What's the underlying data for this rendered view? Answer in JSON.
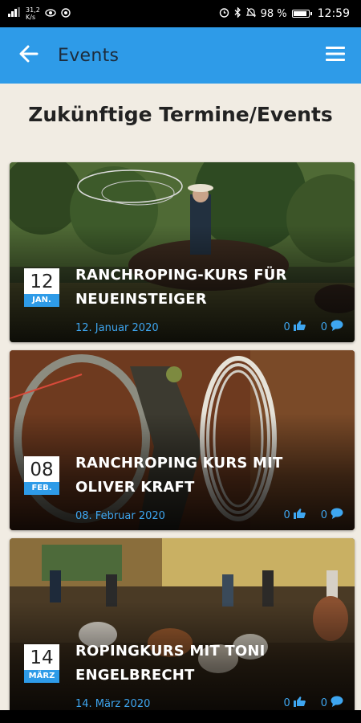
{
  "status_bar": {
    "speed_value": "31,2",
    "speed_unit": "K/s",
    "battery": "98 %",
    "time": "12:59"
  },
  "app_bar": {
    "title": "Events",
    "back_icon": "arrow-left-icon",
    "menu_icon": "hamburger-menu-icon"
  },
  "heading": "Zukünftige Termine/Events",
  "colors": {
    "accent": "#2e9be8",
    "link": "#3ea6f0",
    "background": "#f1ece3"
  },
  "events": [
    {
      "day": "12",
      "month": "JAN.",
      "title": "RANCHROPING-KURS FÜR NEUEINSTEIGER",
      "date": "12. Januar 2020",
      "likes": "0",
      "comments": "0"
    },
    {
      "day": "08",
      "month": "FEB.",
      "title": "RANCHROPING KURS MIT OLIVER KRAFT",
      "date": "08. Februar 2020",
      "likes": "0",
      "comments": "0"
    },
    {
      "day": "14",
      "month": "MÄRZ",
      "title": "ROPINGKURS MIT TONI ENGELBRECHT",
      "date": "14. März 2020",
      "likes": "0",
      "comments": "0"
    }
  ]
}
